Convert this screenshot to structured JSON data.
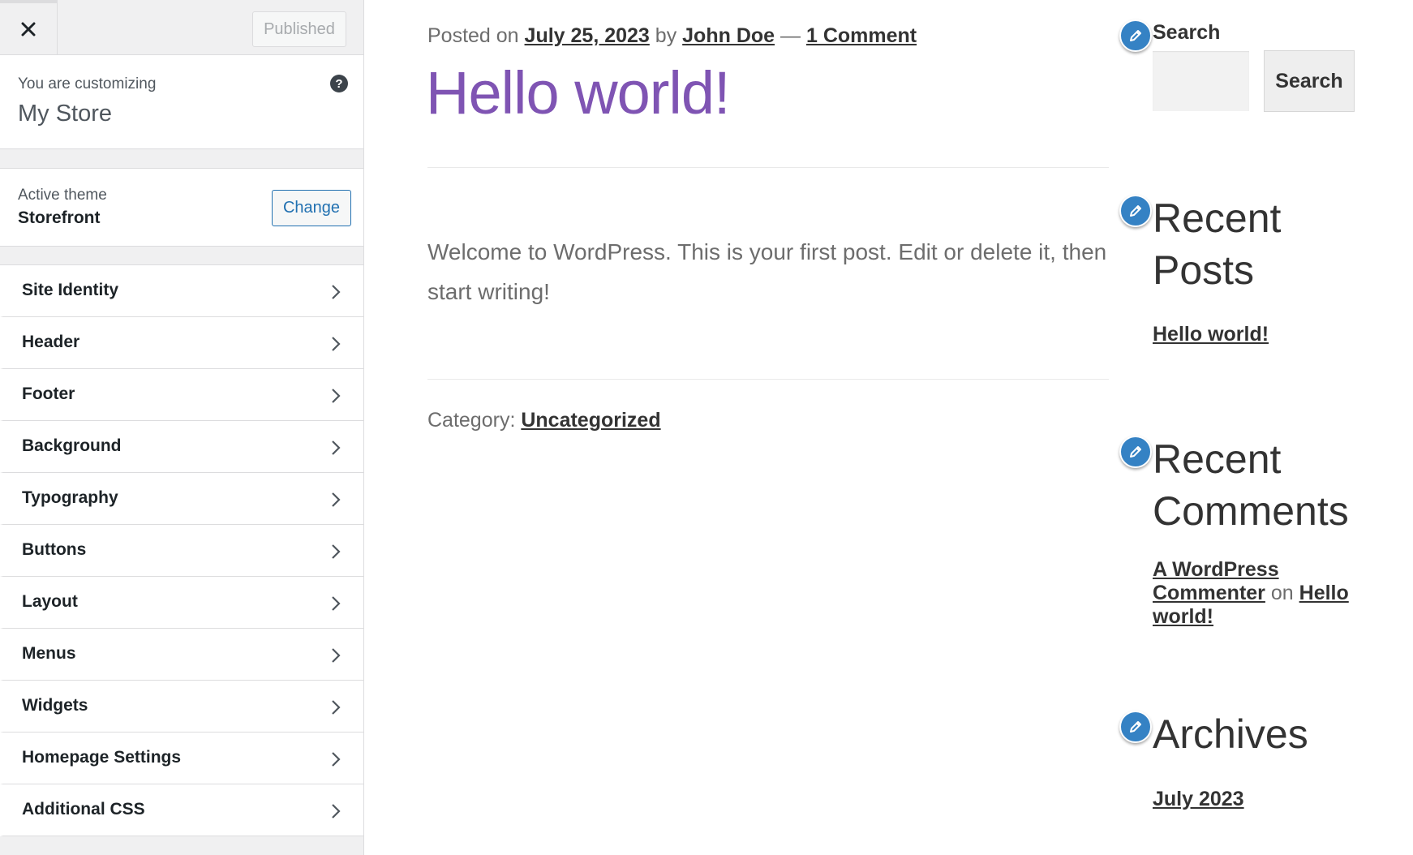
{
  "customizer": {
    "close_label": "Close",
    "published_label": "Published",
    "customizing_label": "You are customizing",
    "store_name": "My Store",
    "help_label": "?",
    "active_theme_label": "Active theme",
    "theme_name": "Storefront",
    "change_label": "Change",
    "menu_items": [
      {
        "label": "Site Identity"
      },
      {
        "label": "Header"
      },
      {
        "label": "Footer"
      },
      {
        "label": "Background"
      },
      {
        "label": "Typography"
      },
      {
        "label": "Buttons"
      },
      {
        "label": "Layout"
      },
      {
        "label": "Menus"
      },
      {
        "label": "Widgets"
      },
      {
        "label": "Homepage Settings"
      },
      {
        "label": "Additional CSS"
      }
    ]
  },
  "post": {
    "posted_on_prefix": "Posted on",
    "date": "July 25, 2023",
    "by_text": "by",
    "author": "John Doe",
    "separator": "—",
    "comments_link": "1 Comment",
    "title": "Hello world!",
    "content": "Welcome to WordPress. This is your first post. Edit or delete it, then start writing!",
    "category_label": "Category:",
    "category": "Uncategorized"
  },
  "widgets": {
    "search": {
      "title": "Search",
      "input_placeholder": "",
      "button_label": "Search"
    },
    "recent_posts": {
      "title": "Recent Posts",
      "items": [
        "Hello world!"
      ]
    },
    "recent_comments": {
      "title": "Recent Comments",
      "author": "A WordPress Commenter",
      "on_text": "on",
      "post": "Hello world!"
    },
    "archives": {
      "title": "Archives",
      "items": [
        "July 2023"
      ]
    }
  },
  "colors": {
    "title_purple": "#7f54b3",
    "shortcut_blue": "#3582c4",
    "wp_blue": "#2271b1"
  },
  "icons": {
    "close": "close-icon",
    "help": "help-icon",
    "chevron": "chevron-right-icon",
    "edit": "pencil-icon"
  }
}
